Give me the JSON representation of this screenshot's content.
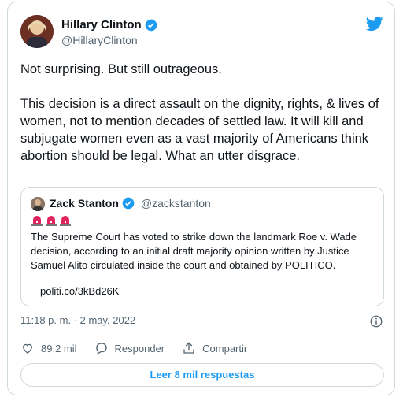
{
  "tweet": {
    "author_name": "Hillary Clinton",
    "author_handle": "@HillaryClinton",
    "text_line_1": "Not surprising. But still outrageous.",
    "text_line_2": "This decision is a direct assault on the dignity, rights, & lives of women, not to mention decades of settled law. It will kill and subjugate women even as a vast majority of Americans think abortion should be legal. What an utter disgrace.",
    "timestamp": "11:18 p. m. · 2 may. 2022",
    "likes": "89,2 mil",
    "reply_label": "Responder",
    "share_label": "Compartir",
    "read_replies": "Leer 8 mil respuestas"
  },
  "quoted": {
    "author_name": "Zack Stanton",
    "author_handle": "@zackstanton",
    "text": "The Supreme Court has voted to strike down the landmark Roe v. Wade decision, according to an initial draft majority opinion written by Justice Samuel Alito circulated inside the court and obtained by POLITICO.",
    "link": "politi.co/3kBd26K"
  },
  "colors": {
    "twitter_blue": "#1d9bf0",
    "verified_blue": "#1d9bf0",
    "border": "#cfd9de",
    "muted": "#536471",
    "siren_red": "#e0245e"
  },
  "icons": [
    "verified-icon",
    "twitter-bird-icon",
    "siren-icon",
    "info-icon",
    "heart-icon",
    "reply-icon",
    "share-icon"
  ]
}
